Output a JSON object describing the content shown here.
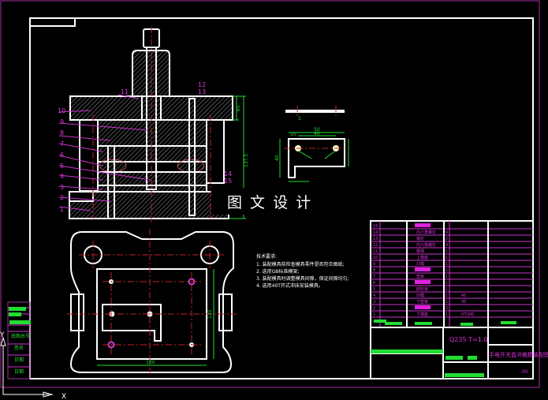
{
  "part_labels": [
    "1",
    "2",
    "3",
    "4",
    "5",
    "6",
    "7",
    "8",
    "9",
    "10",
    "11",
    "12",
    "13",
    "14",
    "15"
  ],
  "dimensions": {
    "upper_plate_height": "65",
    "total_height": "137.5",
    "plan_width": "180",
    "plan_height": "120",
    "part_width": "50",
    "part_hole_spacing": "40",
    "part_edge": "10",
    "part_height": "40",
    "part_thickness": "1"
  },
  "watermark": "图 文 设 计",
  "tech_requirements": {
    "title": "技术要求:",
    "items": [
      "1. 装配模具前检查模具零件是否符合图纸;",
      "2. 选用GB标准模架;",
      "3. 装配模具时调整模具间隙，保证间隙均匀;",
      "4. 选用40T开式冲床安装模具。"
    ]
  },
  "bom": [
    {
      "no": "15",
      "name": "",
      "qty": "",
      "material": ""
    },
    {
      "no": "14",
      "name": "内六角螺钉",
      "qty": "4",
      "material": ""
    },
    {
      "no": "13",
      "name": "销钉",
      "qty": "2",
      "material": ""
    },
    {
      "no": "12",
      "name": "内六角螺钉",
      "qty": "4",
      "material": ""
    },
    {
      "no": "11",
      "name": "模柄",
      "qty": "1",
      "material": ""
    },
    {
      "no": "10",
      "name": "上模座",
      "qty": "1",
      "material": ""
    },
    {
      "no": "9",
      "name": "凸模",
      "qty": "1",
      "material": ""
    },
    {
      "no": "8",
      "name": "",
      "qty": "1",
      "material": ""
    },
    {
      "no": "7",
      "name": "垫板",
      "qty": "1",
      "material": ""
    },
    {
      "no": "6",
      "name": "",
      "qty": "1",
      "material": ""
    },
    {
      "no": "5",
      "name": "卸料板",
      "qty": "1",
      "material": ""
    },
    {
      "no": "4",
      "name": "凹模",
      "qty": "1",
      "material": "45"
    },
    {
      "no": "3",
      "name": "下垫板",
      "qty": "1",
      "material": "45"
    },
    {
      "no": "2",
      "name": "",
      "qty": "2",
      "material": ""
    },
    {
      "no": "1",
      "name": "下模座",
      "qty": "1",
      "material": "HT200"
    }
  ],
  "title_block": {
    "material": "Q235 T=1.0",
    "drawing_title": "手电开关盒冲裁模装配图",
    "drawing_no": "-00"
  },
  "side_stamp": [
    "底图总号",
    "签名",
    "日期",
    "日期"
  ],
  "axis": {
    "x": "X",
    "y": "Y"
  },
  "colors": {
    "background": "#000000",
    "outline": "#ffffff",
    "dimension": "#22dd33",
    "label": "#dd33dd",
    "centerline": "#c0202a"
  }
}
